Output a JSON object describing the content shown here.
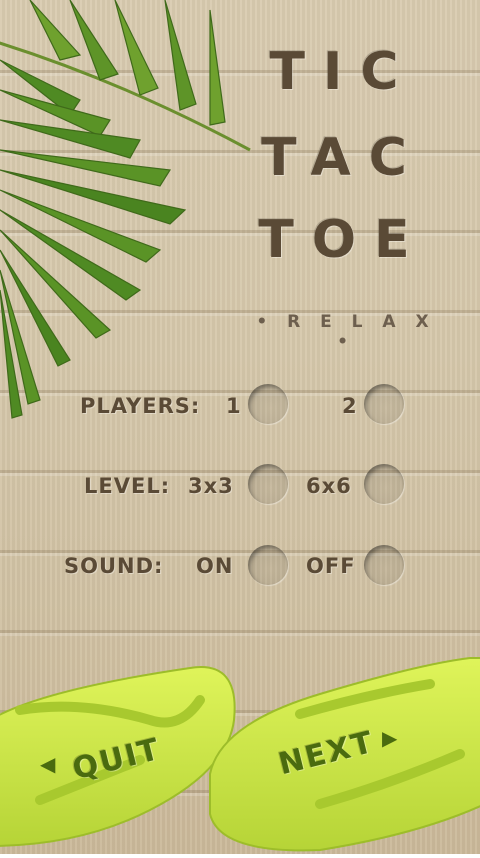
{
  "title": {
    "line1": "TIC",
    "line2": "TAC",
    "line3": "TOE"
  },
  "subtitle": "• R E L A X •",
  "players": {
    "label": "PLAYERS:",
    "options": [
      "1",
      "2"
    ]
  },
  "level": {
    "label": "LEVEL:",
    "options": [
      "3x3",
      "6x6"
    ]
  },
  "sound": {
    "label": "SOUND:",
    "options": [
      "ON",
      "OFF"
    ]
  },
  "buttons": {
    "quit": "QUIT",
    "next": "NEXT"
  },
  "icons": {
    "quit_arrow": "triangle-left-icon",
    "next_arrow": "triangle-right-icon"
  },
  "colors": {
    "wood": "#d6c8ab",
    "text": "#5a4a36",
    "flipflop": "#c8e64a",
    "flipflop_text": "#4a6b0f",
    "palm": "#5b8a2a"
  }
}
